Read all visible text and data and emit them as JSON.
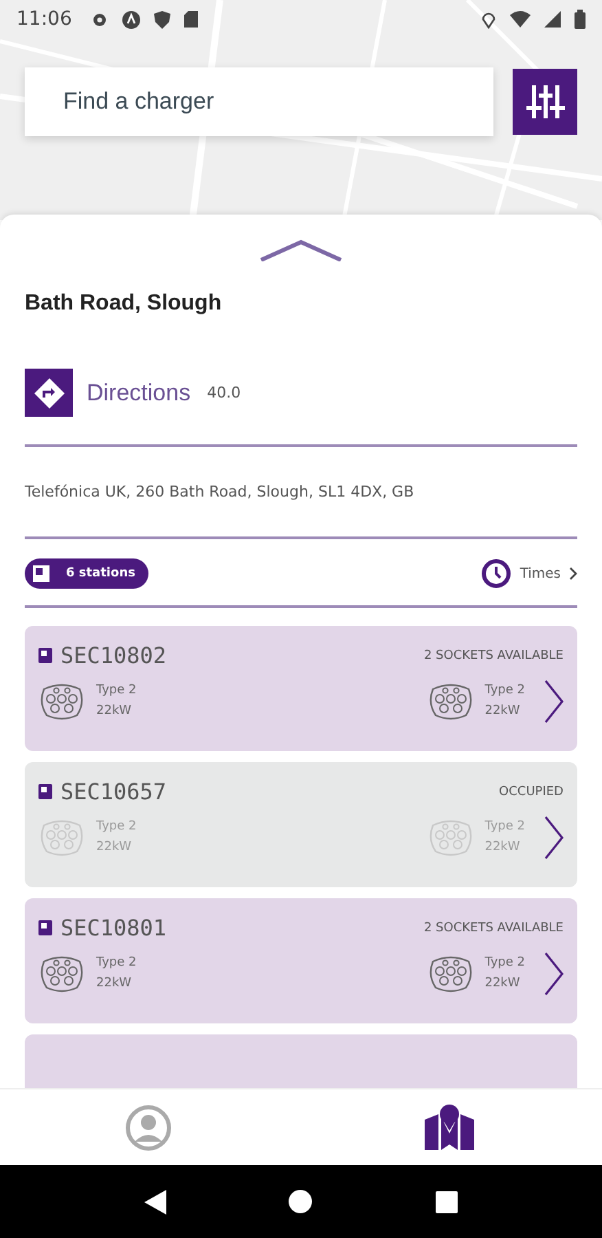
{
  "status_bar": {
    "time": "11:06"
  },
  "search": {
    "placeholder": "Find a charger"
  },
  "location": {
    "title": "Bath Road, Slough",
    "directions_label": "Directions",
    "distance": "40.0",
    "address": "Telefónica UK, 260 Bath Road, Slough, SL1 4DX, GB"
  },
  "summary": {
    "stations": "6 stations",
    "times_label": "Times"
  },
  "stations": [
    {
      "id": "SEC10802",
      "status": "2 SOCKETS AVAILABLE",
      "available": true,
      "sockets": [
        {
          "type": "Type 2",
          "power": "22kW"
        },
        {
          "type": "Type 2",
          "power": "22kW"
        }
      ]
    },
    {
      "id": "SEC10657",
      "status": "OCCUPIED",
      "available": false,
      "sockets": [
        {
          "type": "Type 2",
          "power": "22kW"
        },
        {
          "type": "Type 2",
          "power": "22kW"
        }
      ]
    },
    {
      "id": "SEC10801",
      "status": "2 SOCKETS AVAILABLE",
      "available": true,
      "sockets": [
        {
          "type": "Type 2",
          "power": "22kW"
        },
        {
          "type": "Type 2",
          "power": "22kW"
        }
      ]
    }
  ],
  "bottom_nav": [
    {
      "kind": "profile",
      "selected": false
    },
    {
      "kind": "map",
      "selected": true
    }
  ]
}
